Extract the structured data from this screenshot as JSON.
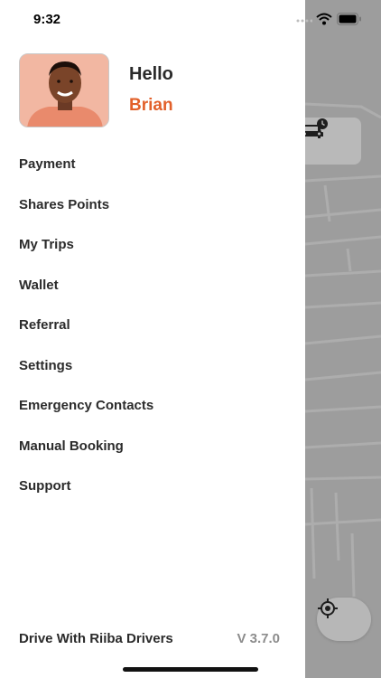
{
  "status_bar": {
    "time": "9:32",
    "wifi_icon": "wifi-icon",
    "battery_icon": "battery-icon"
  },
  "profile": {
    "greeting": "Hello",
    "name": "Brian",
    "name_color": "#e2602a",
    "avatar_icon": "avatar"
  },
  "menu": {
    "items": [
      {
        "label": "Payment"
      },
      {
        "label": "Shares Points"
      },
      {
        "label": "My Trips"
      },
      {
        "label": "Wallet"
      },
      {
        "label": "Referral"
      },
      {
        "label": "Settings"
      },
      {
        "label": "Emergency Contacts"
      },
      {
        "label": "Manual Booking"
      },
      {
        "label": "Support"
      }
    ]
  },
  "footer": {
    "drive_link": "Drive With Riiba Drivers",
    "version": "V 3.7.0"
  },
  "map": {
    "car_icon": "scheduled-car-icon",
    "locate_icon": "locate-icon"
  }
}
